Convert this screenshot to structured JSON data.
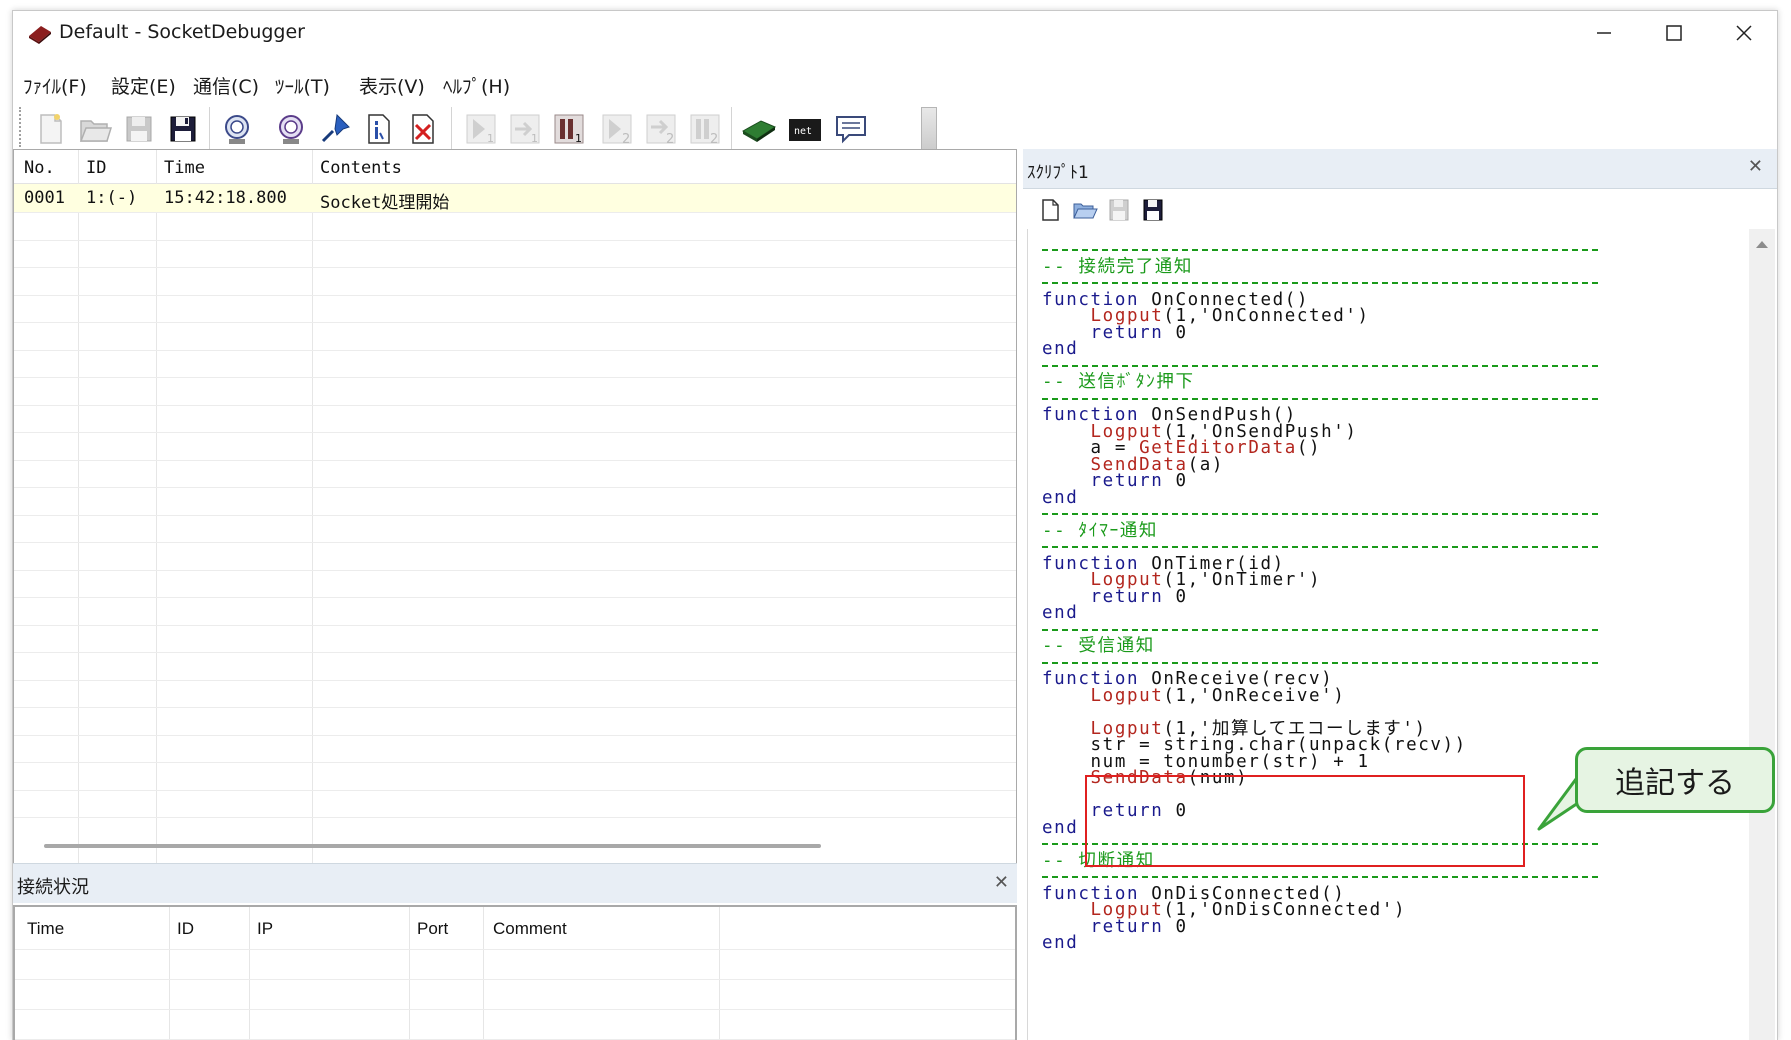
{
  "window": {
    "title": "Default - SocketDebugger"
  },
  "menu": [
    {
      "label": "ﾌｧｲﾙ(F)",
      "name": "menu-file"
    },
    {
      "label": "設定(E)",
      "name": "menu-settings"
    },
    {
      "label": "通信(C)",
      "name": "menu-comm"
    },
    {
      "label": "ﾂｰﾙ(T)",
      "name": "menu-tools"
    },
    {
      "label": "表示(V)",
      "name": "menu-view"
    },
    {
      "label": "ﾍﾙﾌﾟ(H)",
      "name": "menu-help"
    }
  ],
  "toolbar_icons": [
    "new-icon",
    "open-icon",
    "save-icon",
    "save-as-icon",
    "connect-icon",
    "connect-settings-icon",
    "pin-icon",
    "info-icon",
    "clear-icon",
    "send1-icon",
    "send1-repeat-icon",
    "stop1-icon",
    "send2-icon",
    "send2-repeat-icon",
    "stop2-icon",
    "terminal-icon",
    "network-icon",
    "message-icon"
  ],
  "log": {
    "headers": [
      "No.",
      "ID",
      "Time",
      "Contents"
    ],
    "rows": [
      {
        "no": "0001",
        "id": "1:(-)",
        "time": "15:42:18.800",
        "contents": "Socket処理開始"
      }
    ]
  },
  "connection": {
    "title": "接続状況",
    "headers": [
      "Time",
      "ID",
      "IP",
      "Port",
      "Comment"
    ]
  },
  "script": {
    "title": "ｽｸﾘﾌﾟﾄ1",
    "toolbar_icons": [
      "script-new-icon",
      "script-open-icon",
      "script-save-icon",
      "script-save-as-icon"
    ],
    "lines": [
      {
        "t": "dash"
      },
      {
        "t": "comment",
        "text": "-- 接続完了通知"
      },
      {
        "t": "dash"
      },
      {
        "t": "code",
        "parts": [
          [
            "kw",
            "function"
          ],
          [
            "n",
            " OnConnected()"
          ]
        ]
      },
      {
        "t": "code",
        "parts": [
          [
            "n",
            "    "
          ],
          [
            "fn",
            "Logput"
          ],
          [
            "n",
            "(1,'OnConnected')"
          ]
        ]
      },
      {
        "t": "code",
        "parts": [
          [
            "n",
            "    "
          ],
          [
            "kw",
            "return"
          ],
          [
            "n",
            " 0"
          ]
        ]
      },
      {
        "t": "code",
        "parts": [
          [
            "kw",
            "end"
          ]
        ]
      },
      {
        "t": "dash"
      },
      {
        "t": "comment",
        "text": "-- 送信ﾎﾞﾀﾝ押下"
      },
      {
        "t": "dash"
      },
      {
        "t": "code",
        "parts": [
          [
            "kw",
            "function"
          ],
          [
            "n",
            " OnSendPush()"
          ]
        ]
      },
      {
        "t": "code",
        "parts": [
          [
            "n",
            "    "
          ],
          [
            "fn",
            "Logput"
          ],
          [
            "n",
            "(1,'OnSendPush')"
          ]
        ]
      },
      {
        "t": "code",
        "parts": [
          [
            "n",
            "    a = "
          ],
          [
            "fn",
            "GetEditorData"
          ],
          [
            "n",
            "()"
          ]
        ]
      },
      {
        "t": "code",
        "parts": [
          [
            "n",
            "    "
          ],
          [
            "fn",
            "SendData"
          ],
          [
            "n",
            "(a)"
          ]
        ]
      },
      {
        "t": "code",
        "parts": [
          [
            "n",
            "    "
          ],
          [
            "kw",
            "return"
          ],
          [
            "n",
            " 0"
          ]
        ]
      },
      {
        "t": "code",
        "parts": [
          [
            "kw",
            "end"
          ]
        ]
      },
      {
        "t": "dash"
      },
      {
        "t": "comment",
        "text": "-- ﾀｲﾏｰ通知"
      },
      {
        "t": "dash"
      },
      {
        "t": "code",
        "parts": [
          [
            "kw",
            "function"
          ],
          [
            "n",
            " OnTimer(id)"
          ]
        ]
      },
      {
        "t": "code",
        "parts": [
          [
            "n",
            "    "
          ],
          [
            "fn",
            "Logput"
          ],
          [
            "n",
            "(1,'OnTimer')"
          ]
        ]
      },
      {
        "t": "code",
        "parts": [
          [
            "n",
            "    "
          ],
          [
            "kw",
            "return"
          ],
          [
            "n",
            " 0"
          ]
        ]
      },
      {
        "t": "code",
        "parts": [
          [
            "kw",
            "end"
          ]
        ]
      },
      {
        "t": "dash"
      },
      {
        "t": "comment",
        "text": "-- 受信通知"
      },
      {
        "t": "dash"
      },
      {
        "t": "code",
        "parts": [
          [
            "kw",
            "function"
          ],
          [
            "n",
            " OnReceive(recv)"
          ]
        ]
      },
      {
        "t": "code",
        "parts": [
          [
            "n",
            "    "
          ],
          [
            "fn",
            "Logput"
          ],
          [
            "n",
            "(1,'OnReceive')"
          ]
        ]
      },
      {
        "t": "blank"
      },
      {
        "t": "code",
        "parts": [
          [
            "n",
            "    "
          ],
          [
            "fn",
            "Logput"
          ],
          [
            "n",
            "(1,'加算してエコーします')"
          ]
        ]
      },
      {
        "t": "code",
        "parts": [
          [
            "n",
            "    str = string.char(unpack(recv))"
          ]
        ]
      },
      {
        "t": "code",
        "parts": [
          [
            "n",
            "    num = tonumber(str) + 1"
          ]
        ]
      },
      {
        "t": "code",
        "parts": [
          [
            "n",
            "    "
          ],
          [
            "fn",
            "SendData"
          ],
          [
            "n",
            "(num)"
          ]
        ]
      },
      {
        "t": "blank"
      },
      {
        "t": "code",
        "parts": [
          [
            "n",
            "    "
          ],
          [
            "kw",
            "return"
          ],
          [
            "n",
            " 0"
          ]
        ]
      },
      {
        "t": "code",
        "parts": [
          [
            "kw",
            "end"
          ]
        ]
      },
      {
        "t": "dash"
      },
      {
        "t": "comment",
        "text": "-- 切断通知"
      },
      {
        "t": "dash"
      },
      {
        "t": "code",
        "parts": [
          [
            "kw",
            "function"
          ],
          [
            "n",
            " OnDisConnected()"
          ]
        ]
      },
      {
        "t": "code",
        "parts": [
          [
            "n",
            "    "
          ],
          [
            "fn",
            "Logput"
          ],
          [
            "n",
            "(1,'OnDisConnected')"
          ]
        ]
      },
      {
        "t": "code",
        "parts": [
          [
            "n",
            "    "
          ],
          [
            "kw",
            "return"
          ],
          [
            "n",
            " 0"
          ]
        ]
      },
      {
        "t": "code",
        "parts": [
          [
            "kw",
            "end"
          ]
        ]
      }
    ]
  },
  "annotation": {
    "label": "追記する",
    "border_color": "#3aa33a",
    "highlight_color": "#e02020"
  },
  "colors": {
    "comment": "#1a9a1a",
    "keyword": "#1a1a8c",
    "function": "#b3261e",
    "log_row_bg": "#ffffe0"
  }
}
